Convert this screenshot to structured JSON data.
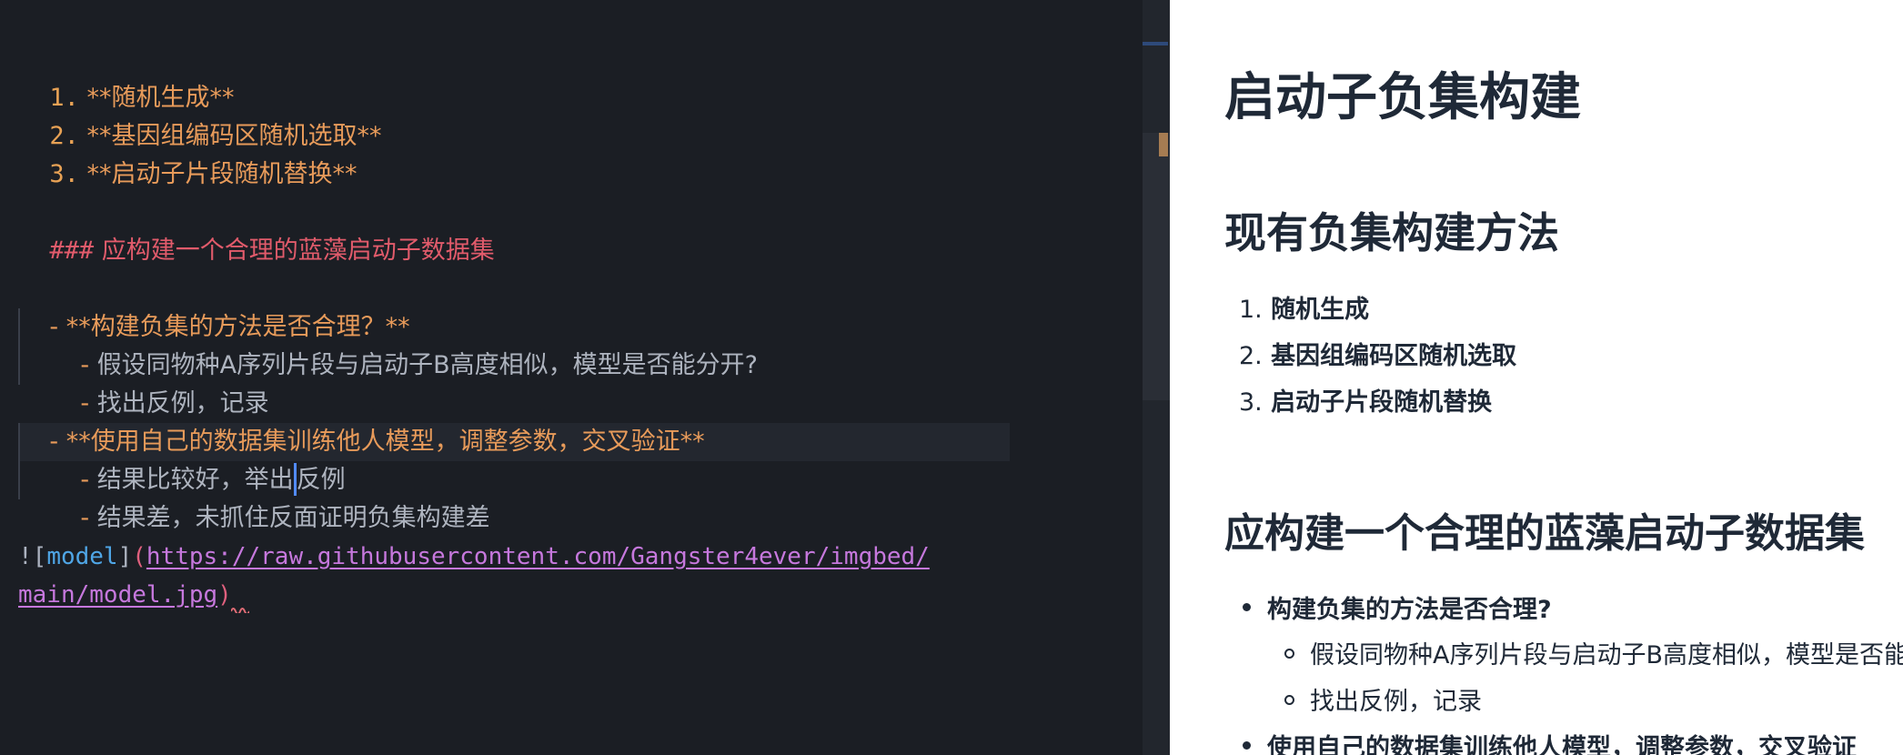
{
  "editor": {
    "lines": {
      "l1": {
        "num": "1.",
        "text": "**随机生成**"
      },
      "l2": {
        "num": "2.",
        "text": "**基因组编码区随机选取**"
      },
      "l3": {
        "num": "3.",
        "text": "**启动子片段随机替换**"
      },
      "h3_marker": "###",
      "h3_text": "应构建一个合理的蓝藻启动子数据集",
      "b1_dash": "-",
      "b1_text": "**构建负集的方法是否合理？**",
      "b1a_dash": "-",
      "b1a_text": "假设同物种A序列片段与启动子B高度相似，模型是否能分开?",
      "b1b_dash": "-",
      "b1b_text": "找出反例，记录",
      "b2_dash": "-",
      "b2_text": "**使用自己的数据集训练他人模型，调整参数，交叉验证**",
      "b2a_dash": "-",
      "b2a_text_before": "结果比较好，举出",
      "b2a_text_after": "反例",
      "b2b_dash": "-",
      "b2b_text": "结果差，未抓住反面证明负集构建差",
      "img_bang": "!",
      "img_open": "[",
      "img_alt": "model",
      "img_close": "]",
      "img_paren_open": "(",
      "img_url_1": "https://raw.githubusercontent.com/Gangster4ever/imgbed/",
      "img_url_2": "main/model.jpg",
      "img_paren_close": ")"
    }
  },
  "preview": {
    "h1": "启动子负集构建",
    "h2": "现有负集构建方法",
    "ol": [
      {
        "num": "1.",
        "text": "随机生成"
      },
      {
        "num": "2.",
        "text": "基因组编码区随机选取"
      },
      {
        "num": "3.",
        "text": "启动子片段随机替换"
      }
    ],
    "h3": "应构建一个合理的蓝藻启动子数据集",
    "ul": [
      {
        "text": "构建负集的方法是否合理?"
      },
      {
        "text": "假设同物种A序列片段与启动子B高度相似，模型是否能分开?"
      },
      {
        "text": "找出反例，记录"
      },
      {
        "text": "使用自己的数据集训练他人模型，调整参数，交叉验证"
      }
    ]
  },
  "colors": {
    "editor_bg": "#1b1e24",
    "bold_orange": "#e89b5a",
    "heading_red": "#e15b6b",
    "link_purple": "#c678dd",
    "alt_blue": "#4fa6e6",
    "preview_bg": "#ffffff"
  }
}
